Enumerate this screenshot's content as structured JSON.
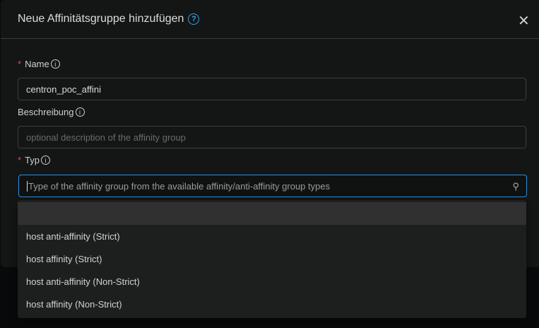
{
  "dialog": {
    "title": "Neue Affinitätsgruppe hinzufügen",
    "close": "✕",
    "help": "?"
  },
  "form": {
    "name": {
      "label": "Name",
      "value": "centron_poc_affini"
    },
    "description": {
      "label": "Beschreibung",
      "placeholder": "optional description of the affinity group"
    },
    "type": {
      "label": "Typ",
      "placeholder": "Type of the affinity group from the available affinity/anti-affinity group types"
    }
  },
  "dropdown": {
    "options": [
      "",
      "host anti-affinity (Strict)",
      "host affinity (Strict)",
      "host anti-affinity (Non-Strict)",
      "host affinity (Non-Strict)"
    ]
  }
}
